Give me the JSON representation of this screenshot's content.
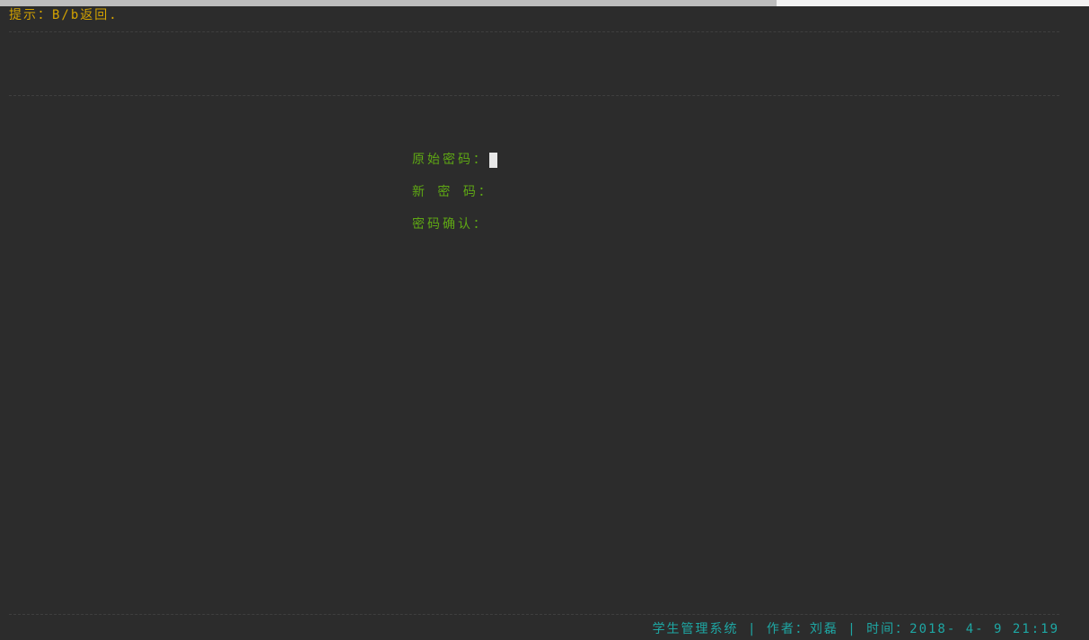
{
  "theme": {
    "hint_color": "#d4a300",
    "label_color": "#5fa814",
    "status_color": "#1ea7a4",
    "background": "#2c2c2c"
  },
  "hint": {
    "text": "提示：B/b返回."
  },
  "form": {
    "fields": [
      {
        "label": "原始密码：",
        "value": ""
      },
      {
        "label": "新 密 码：",
        "value": ""
      },
      {
        "label": "密码确认：",
        "value": ""
      }
    ]
  },
  "status_bar": {
    "text": "学生管理系统 | 作者：刘磊 | 时间：2018- 4- 9 21:19"
  }
}
